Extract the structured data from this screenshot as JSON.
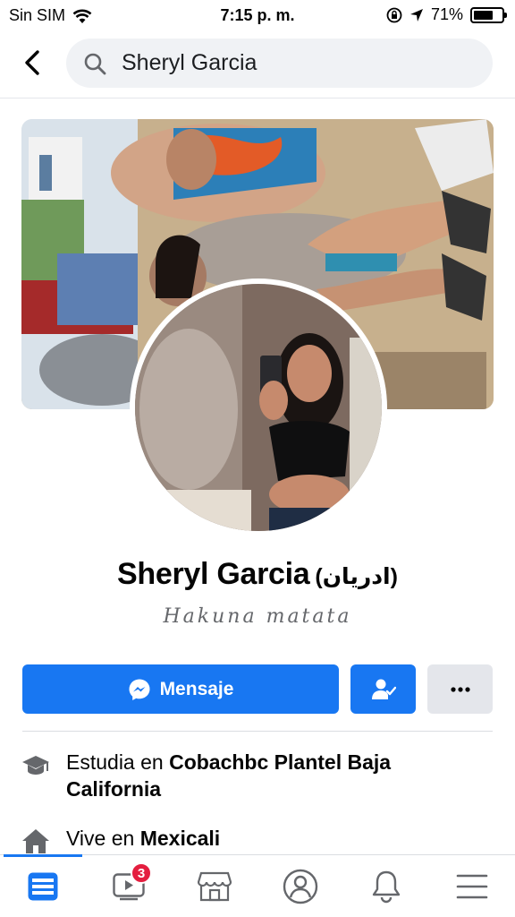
{
  "status_bar": {
    "carrier": "Sin SIM",
    "time": "7:15 p. m.",
    "battery_percent": "71%",
    "battery_level": 0.71
  },
  "search": {
    "query": "Sheryl Garcia"
  },
  "profile": {
    "name": "Sheryl Garcia",
    "alternate_name": "(ادريان)",
    "bio": "Hakuna matata"
  },
  "actions": {
    "message_label": "Mensaje"
  },
  "info": {
    "study_prefix": "Estudia en ",
    "study_place": "Cobachbc Plantel Baja California",
    "lives_prefix": "Vive en ",
    "lives_place": "Mexicali"
  },
  "nav": {
    "video_badge": "3",
    "items": [
      "feed-icon",
      "video-icon",
      "marketplace-icon",
      "profile-icon",
      "bell-icon",
      "menu-icon"
    ]
  },
  "colors": {
    "accent": "#1877f2",
    "badge": "#e41e3f"
  }
}
